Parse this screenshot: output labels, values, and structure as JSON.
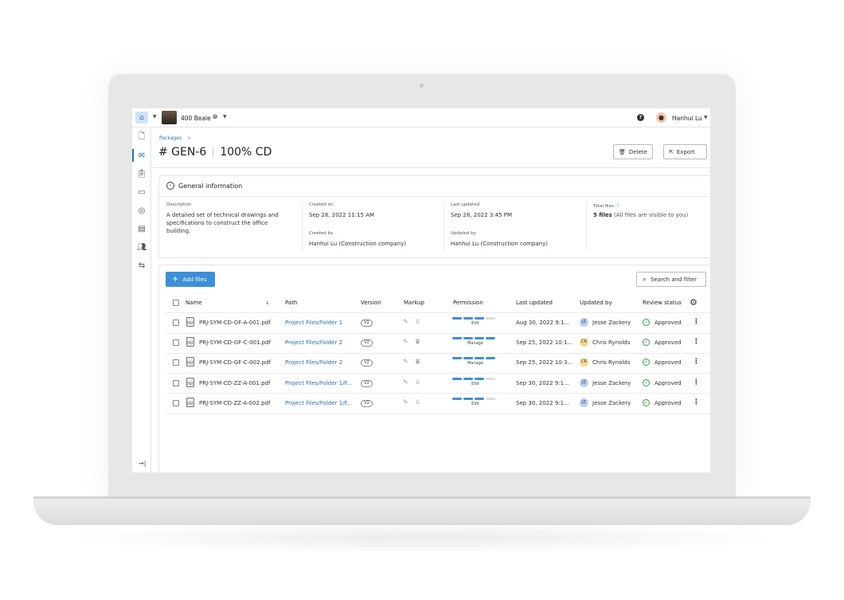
{
  "topbar": {
    "project_name": "400 Beale",
    "user_name": "Hanhui Lu"
  },
  "breadcrumb": {
    "parent": "Packages",
    "separator": ">"
  },
  "header": {
    "package_id": "# GEN-6",
    "package_name": "100% CD",
    "delete_label": "Delete",
    "export_label": "Export"
  },
  "general_info": {
    "title": "General information",
    "description_label": "Description",
    "description_lines": [
      "A detailed set of technical drawings and",
      "specifications to construct the office",
      "building."
    ],
    "created_on_label": "Created on",
    "created_on": "Sep 28, 2022 11:15 AM",
    "created_by_label": "Created by",
    "created_by": "Hanhui Lu (Construction company)",
    "last_updated_label": "Last updated",
    "last_updated": "Sep 28, 2022 3:45 PM",
    "updated_by_label": "Updated by",
    "updated_by": "Hanhui Lu (Construction company)",
    "total_files_label": "Total files",
    "total_files_count": "5 files",
    "total_files_note": "(All files are visible to you)"
  },
  "files": {
    "add_label": "Add files",
    "search_label": "Search and filter",
    "columns": {
      "name": "Name",
      "path": "Path",
      "version": "Version",
      "markup": "Markup",
      "permission": "Permission",
      "last_updated": "Last updated",
      "updated_by": "Updated by",
      "review_status": "Review status"
    },
    "rows": [
      {
        "name": "PRJ-SYM-CD-GF-A-001.pdf",
        "path": "Project Files/Folder 1",
        "version": "V2",
        "permission": "Edit",
        "level": 3,
        "last_updated": "Aug 30, 2022 9:1...",
        "initials": "JZ",
        "updated_by": "Jesse Zackery",
        "avatar_color": "#b9cfee",
        "status": "Approved",
        "markup_dark": false
      },
      {
        "name": "PRJ-SYM-CD-GF-C-001.pdf",
        "path": "Project Files/Folder 2",
        "version": "V2",
        "permission": "Manage",
        "level": 4,
        "last_updated": "Sep 25, 2022 10:1...",
        "initials": "CR",
        "updated_by": "Chris Rynolds",
        "avatar_color": "#f6d98f",
        "status": "Approved",
        "markup_dark": true
      },
      {
        "name": "PRJ-SYM-CD-GF-C-002.pdf",
        "path": "Project Files/Folder 2",
        "version": "V2",
        "permission": "Manage",
        "level": 4,
        "last_updated": "Sep 25, 2022 10:3...",
        "initials": "CR",
        "updated_by": "Chris Rynolds",
        "avatar_color": "#f6d98f",
        "status": "Approved",
        "markup_dark": true
      },
      {
        "name": "PRJ-SYM-CD-ZZ-A-001.pdf",
        "path": "Project Files/Folder 1/F...",
        "version": "V2",
        "permission": "Edit",
        "level": 3,
        "last_updated": "Sep 30, 2022 9:1...",
        "initials": "JZ",
        "updated_by": "Jesse Zackery",
        "avatar_color": "#b9cfee",
        "status": "Approved",
        "markup_dark": false
      },
      {
        "name": "PRJ-SYM-CD-ZZ-A-002.pdf",
        "path": "Project Files/Folder 1/F...",
        "version": "V2",
        "permission": "Edit",
        "level": 3,
        "last_updated": "Sep 30, 2022 9:1...",
        "initials": "JZ",
        "updated_by": "Jesse Zackery",
        "avatar_color": "#b9cfee",
        "status": "Approved",
        "markup_dark": false
      }
    ]
  },
  "colors": {
    "accent": "#3d8fd9",
    "link": "#2b6fb3",
    "approved": "#3a9b4a"
  }
}
